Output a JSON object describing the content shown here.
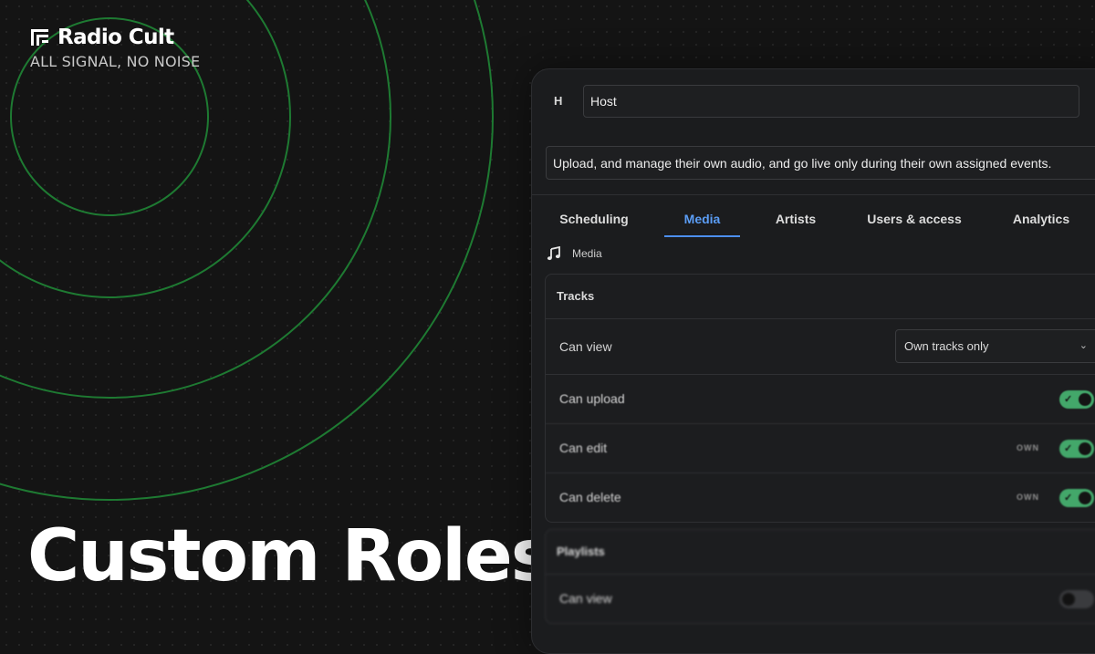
{
  "brand": {
    "name": "Radio Cult",
    "tagline": "ALL SIGNAL, NO NOISE",
    "logo_icon": "radiocult-logo-icon"
  },
  "hero": {
    "title": "Custom Roles"
  },
  "colors": {
    "background": "#141414",
    "ring": "#1e7a32",
    "accent_blue": "#4d8ff0",
    "toggle_on": "#43a76a",
    "panel": "#1b1c1e"
  },
  "role": {
    "initial": "H",
    "name": "Host",
    "description": "Upload, and manage their own audio, and go live only during their own assigned events."
  },
  "tabs": [
    {
      "label": "Scheduling",
      "active": false
    },
    {
      "label": "Media",
      "active": true
    },
    {
      "label": "Artists",
      "active": false
    },
    {
      "label": "Users & access",
      "active": false
    },
    {
      "label": "Analytics",
      "active": false
    }
  ],
  "section": {
    "label": "Media",
    "icon": "music-note-icon"
  },
  "tracks": {
    "title": "Tracks",
    "can_view": {
      "label": "Can view",
      "value": "Own tracks only",
      "icon": "chevron-down-icon"
    },
    "can_upload": {
      "label": "Can upload",
      "enabled": true
    },
    "can_edit": {
      "label": "Can edit",
      "badge": "OWN",
      "enabled": true
    },
    "can_delete": {
      "label": "Can delete",
      "badge": "OWN",
      "enabled": true
    }
  },
  "playlists": {
    "title": "Playlists",
    "can_view": {
      "label": "Can view",
      "enabled": false
    }
  }
}
